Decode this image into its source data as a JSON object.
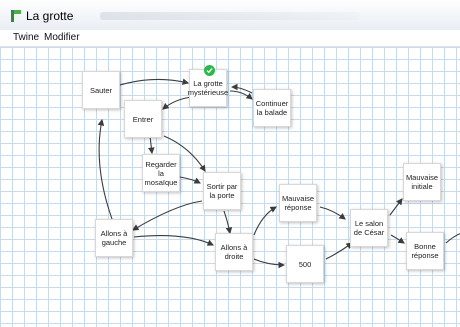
{
  "window": {
    "title": "La grotte"
  },
  "menu": {
    "items": [
      "Twine",
      "Modifier"
    ]
  },
  "passages": {
    "sauter": "Sauter",
    "grotte": "La grotte mystérieuse",
    "continuer": "Continuer la balade",
    "entrer": "Entrer",
    "regarder": "Regarder la mosaïque",
    "sortir": "Sortir par la porte",
    "allons_gauche": "Allons à gauche",
    "allons_droite": "Allons à droite",
    "mauvaise_reponse": "Mauvaise réponse",
    "n500": "500",
    "salon": "Le salon de César",
    "mauvaise_initiale": "Mauvaise initiale",
    "bonne_reponse": "Bonne réponse"
  },
  "colors": {
    "grid": "#c9daea",
    "link": "#3c3c3c",
    "start_badge": "#2eb84b"
  }
}
